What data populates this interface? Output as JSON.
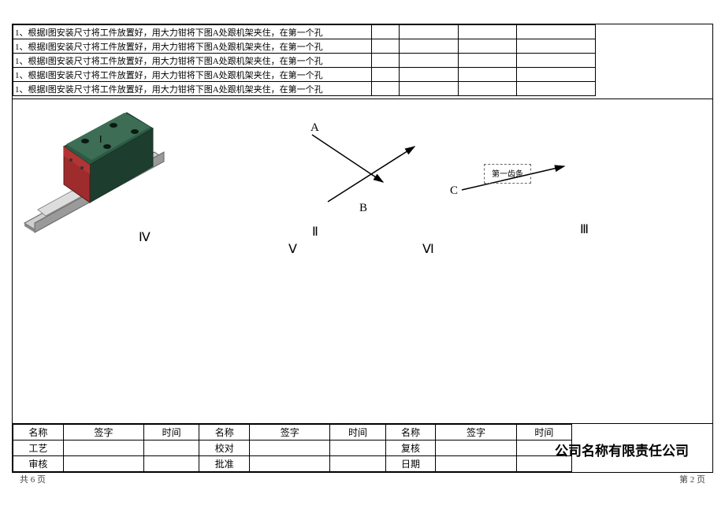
{
  "instruction_rows": [
    {
      "text": "1、根据Ⅰ图安装尺寸将工件放置好，用大力钳将下图A处跟机架夹住，在第一个孔"
    },
    {
      "text": "1、根据Ⅰ图安装尺寸将工件放置好，用大力钳将下图A处跟机架夹住，在第一个孔"
    },
    {
      "text": "1、根据Ⅰ图安装尺寸将工件放置好，用大力钳将下图A处跟机架夹住，在第一个孔"
    },
    {
      "text": "1、根据Ⅰ图安装尺寸将工件放置好，用大力钳将下图A处跟机架夹住，在第一个孔"
    },
    {
      "text": "1、根据Ⅰ图安装尺寸将工件放置好，用大力钳将下图A处跟机架夹住，在第一个孔"
    }
  ],
  "labels": {
    "A": "A",
    "B": "B",
    "C": "C",
    "I": "Ⅰ",
    "II": "Ⅱ",
    "III": "Ⅲ",
    "IV": "Ⅳ",
    "V": "Ⅴ",
    "VI": "Ⅵ",
    "box": "第一齿条"
  },
  "title_block": {
    "r1": {
      "c1": "名称",
      "c2": "签字",
      "c3": "时间",
      "c4": "名称",
      "c5": "签字",
      "c6": "时间",
      "c7": "名称",
      "c8": "签字",
      "c9": "时间"
    },
    "r2": {
      "c1": "工艺",
      "c2": "",
      "c3": "",
      "c4": "校对",
      "c5": "",
      "c6": "",
      "c7": "复核",
      "c8": "",
      "c9": ""
    },
    "r3": {
      "c1": "审核",
      "c2": "",
      "c3": "",
      "c4": "批准",
      "c5": "",
      "c6": "",
      "c7": "日期",
      "c8": "",
      "c9": ""
    }
  },
  "company": "公司名称有限责任公司",
  "footer_left": "共 6 页",
  "footer_right": "第 2  页"
}
